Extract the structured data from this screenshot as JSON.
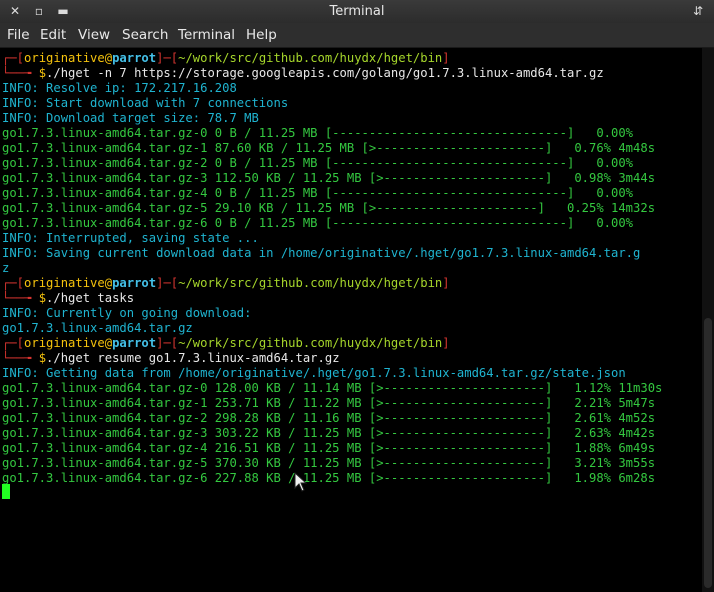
{
  "window": {
    "title": "Terminal"
  },
  "menu": [
    "File",
    "Edit",
    "View",
    "Search",
    "Terminal",
    "Help"
  ],
  "prompt": {
    "user": "originative",
    "at": "@",
    "host": "parrot",
    "path": "~/work/src/github.com/huydx/hget/bin",
    "dollar": "$"
  },
  "commands": [
    "./hget -n 7 https://storage.googleapis.com/golang/go1.7.3.linux-amd64.tar.gz",
    "./hget tasks",
    "./hget resume go1.7.3.linux-amd64.tar.gz"
  ],
  "block1": {
    "info": [
      "INFO: Resolve ip: 172.217.16.208",
      "INFO: Start download with 7 connections",
      "INFO: Download target size: 78.7 MB"
    ],
    "progress": [
      "go1.7.3.linux-amd64.tar.gz-0 0 B / 11.25 MB [--------------------------------]   0.00%",
      "go1.7.3.linux-amd64.tar.gz-1 87.60 KB / 11.25 MB [>-----------------------]   0.76% 4m48s",
      "go1.7.3.linux-amd64.tar.gz-2 0 B / 11.25 MB [--------------------------------]   0.00%",
      "go1.7.3.linux-amd64.tar.gz-3 112.50 KB / 11.25 MB [>----------------------]   0.98% 3m44s",
      "go1.7.3.linux-amd64.tar.gz-4 0 B / 11.25 MB [--------------------------------]   0.00%",
      "go1.7.3.linux-amd64.tar.gz-5 29.10 KB / 11.25 MB [>----------------------]   0.25% 14m32s",
      "go1.7.3.linux-amd64.tar.gz-6 0 B / 11.25 MB [--------------------------------]   0.00%"
    ],
    "after": [
      "INFO: Interrupted, saving state ...",
      "INFO: Saving current download data in /home/originative/.hget/go1.7.3.linux-amd64.tar.g",
      "z"
    ]
  },
  "block2": {
    "info": "INFO: Currently on going download:",
    "item": "go1.7.3.linux-amd64.tar.gz"
  },
  "block3": {
    "info": "INFO: Getting data from /home/originative/.hget/go1.7.3.linux-amd64.tar.gz/state.json",
    "progress": [
      "go1.7.3.linux-amd64.tar.gz-0 128.00 KB / 11.14 MB [>----------------------]   1.12% 11m30s",
      "go1.7.3.linux-amd64.tar.gz-1 253.71 KB / 11.22 MB [>----------------------]   2.21% 5m47s",
      "go1.7.3.linux-amd64.tar.gz-2 298.28 KB / 11.16 MB [>----------------------]   2.61% 4m52s",
      "go1.7.3.linux-amd64.tar.gz-3 303.22 KB / 11.25 MB [>----------------------]   2.63% 4m42s",
      "go1.7.3.linux-amd64.tar.gz-4 216.51 KB / 11.25 MB [>----------------------]   1.88% 6m49s",
      "go1.7.3.linux-amd64.tar.gz-5 370.30 KB / 11.25 MB [>----------------------]   3.21% 3m55s",
      "go1.7.3.linux-amd64.tar.gz-6 227.88 KB / 11.25 MB [>----------------------]   1.98% 6m28s"
    ]
  },
  "colors": {
    "prompt_frame": "#d4342f",
    "user": "#f4c20d",
    "host": "#44c0e8",
    "progress": "#34c840",
    "info": "#1fb4d0",
    "cursor": "#22ff22"
  },
  "icons": {
    "close": "close-icon",
    "stick": "pin-icon",
    "maximize": "maximize-icon",
    "mouse": "mouse-pointer-icon"
  }
}
